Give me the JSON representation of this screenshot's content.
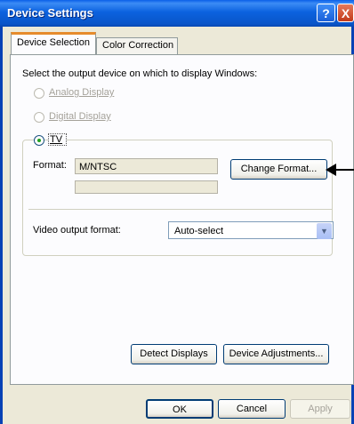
{
  "window": {
    "title": "Device Settings",
    "help_glyph": "?",
    "close_glyph": "X"
  },
  "tabs": [
    {
      "label": "Device Selection"
    },
    {
      "label": "Color Correction"
    }
  ],
  "instruction": "Select the output device on which to display Windows:",
  "radios": {
    "analog": {
      "label": "Analog Display"
    },
    "digital": {
      "label": "Digital Display"
    },
    "tv": {
      "label": "TV"
    }
  },
  "format": {
    "label": "Format:",
    "value": "M/NTSC",
    "change_button": "Change Format..."
  },
  "video_output": {
    "label": "Video output format:",
    "selected": "Auto-select"
  },
  "buttons": {
    "detect": "Detect Displays",
    "adjust": "Device Adjustments...",
    "ok": "OK",
    "cancel": "Cancel",
    "apply": "Apply"
  },
  "icons": [
    "help-icon",
    "close-icon",
    "chevron-down-icon",
    "pointer-arrow-icon"
  ]
}
